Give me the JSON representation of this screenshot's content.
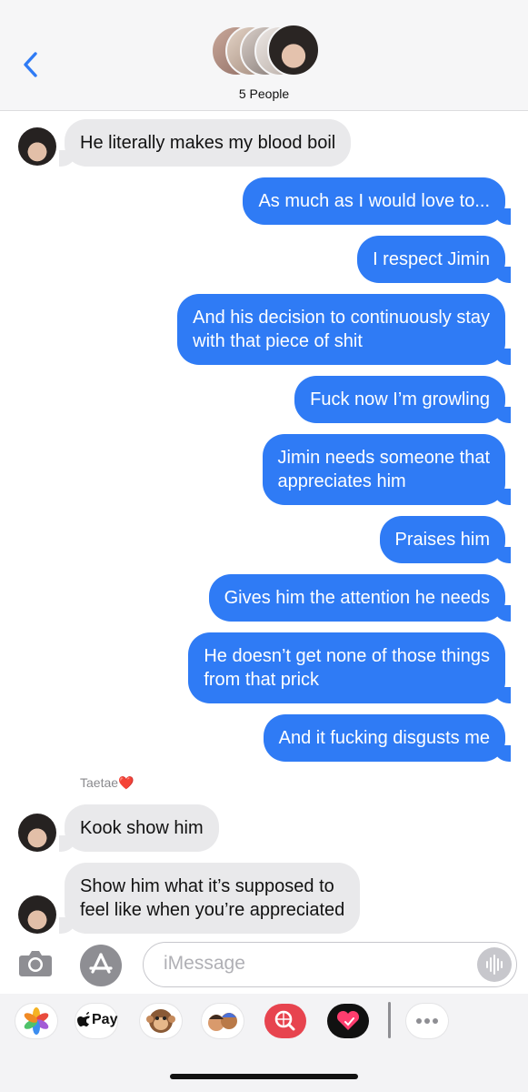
{
  "header": {
    "people_label": "5 People",
    "back_icon": "chevron-left-icon"
  },
  "messages": [
    {
      "side": "incoming",
      "text_lines": [
        "He literally makes my blood boil"
      ]
    },
    {
      "side": "outgoing",
      "text_lines": [
        "As much as I would love to..."
      ]
    },
    {
      "side": "outgoing",
      "text_lines": [
        "I respect Jimin"
      ]
    },
    {
      "side": "outgoing",
      "text_lines": [
        "And his decision to continuously stay",
        "with that piece of shit"
      ]
    },
    {
      "side": "outgoing",
      "text_lines": [
        "Fuck now I’m growling"
      ]
    },
    {
      "side": "outgoing",
      "text_lines": [
        "Jimin needs someone that",
        "appreciates him"
      ]
    },
    {
      "side": "outgoing",
      "text_lines": [
        "Praises him"
      ]
    },
    {
      "side": "outgoing",
      "text_lines": [
        "Gives him the attention he needs"
      ]
    },
    {
      "side": "outgoing",
      "text_lines": [
        "He doesn’t get none of those things",
        "from that prick"
      ]
    },
    {
      "side": "outgoing",
      "text_lines": [
        "And it fucking disgusts me"
      ]
    },
    {
      "side": "incoming",
      "sender": "Taetae❤️",
      "text_lines": [
        "Kook show him"
      ]
    },
    {
      "side": "incoming",
      "text_lines": [
        "Show him what it’s supposed to",
        "feel like when you’re appreciated"
      ]
    }
  ],
  "input": {
    "placeholder": "iMessage",
    "camera_icon": "camera-icon",
    "apps_icon": "app-store-icon",
    "audio_icon": "waveform-icon"
  },
  "apps": [
    {
      "name": "photos-app-icon"
    },
    {
      "name": "apple-pay-app-icon",
      "label": "Pay"
    },
    {
      "name": "monkey-memoji-icon"
    },
    {
      "name": "memoji-stickers-icon"
    },
    {
      "name": "web-search-icon"
    },
    {
      "name": "digital-touch-icon"
    },
    {
      "name": "more-apps-icon"
    }
  ],
  "colors": {
    "outgoing_bubble": "#2f7bf5",
    "incoming_bubble": "#e9e9eb",
    "header_bg": "#f6f6f7"
  }
}
